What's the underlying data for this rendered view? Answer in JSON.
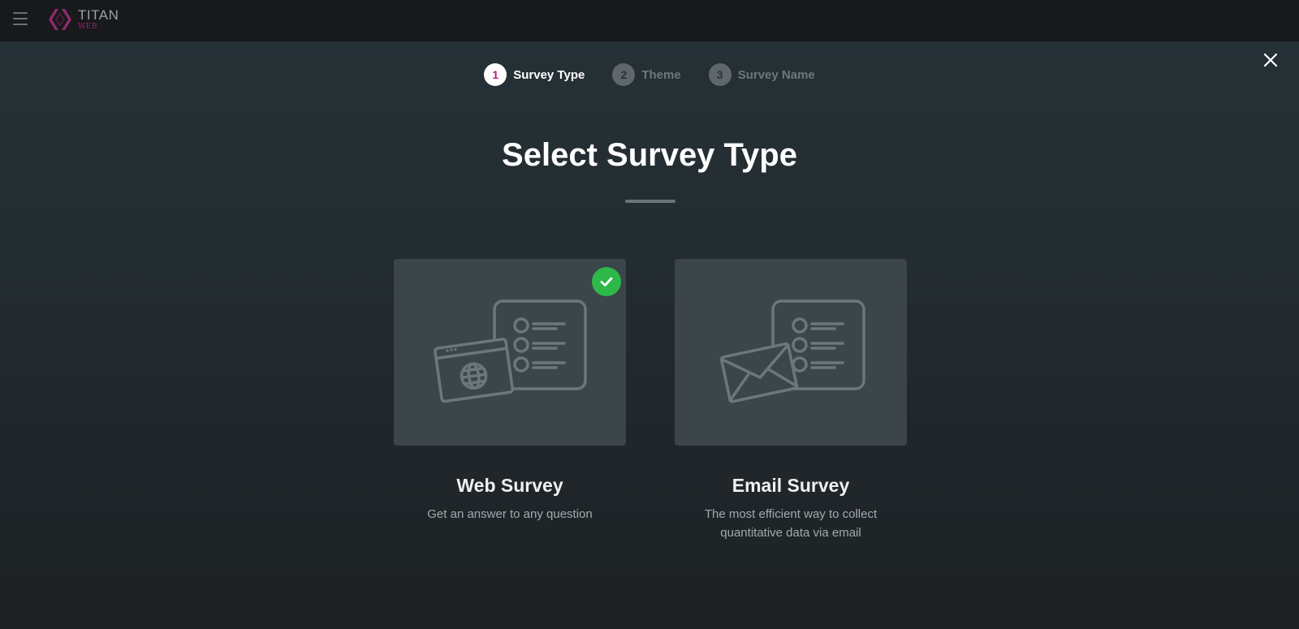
{
  "app": {
    "logo_title": "TITAN",
    "logo_sub": "WEB",
    "brand_color": "#8e2a6e"
  },
  "wizard": {
    "steps": [
      {
        "number": "1",
        "label": "Survey Type",
        "state": "active"
      },
      {
        "number": "2",
        "label": "Theme",
        "state": "inactive"
      },
      {
        "number": "3",
        "label": "Survey Name",
        "state": "inactive"
      }
    ],
    "title": "Select Survey Type",
    "options": [
      {
        "title": "Web Survey",
        "description": "Get an answer to any question",
        "selected": true,
        "icon": "web-survey-illustration"
      },
      {
        "title": "Email Survey",
        "description": "The most efficient way to collect quantitative data via email",
        "selected": false,
        "icon": "email-survey-illustration"
      }
    ]
  },
  "colors": {
    "accent_step": "#c2187a",
    "selected_check": "#2db84a",
    "card_bg": "#3b454a"
  }
}
